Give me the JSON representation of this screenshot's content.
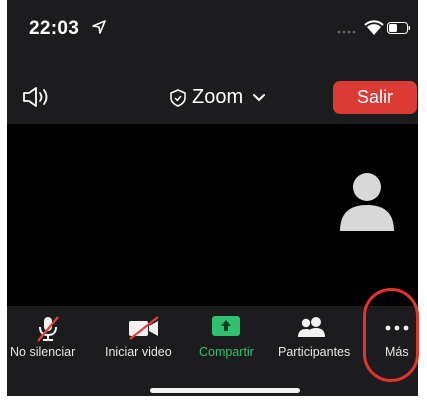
{
  "status": {
    "time": "22:03",
    "icons": [
      "location-arrow-icon",
      "signal-dots-icon",
      "wifi-icon",
      "battery-icon"
    ]
  },
  "header": {
    "title": "Zoom",
    "leave_label": "Salir",
    "icons": [
      "speaker-icon",
      "shield-icon",
      "chevron-down-icon"
    ]
  },
  "toolbar": {
    "items": [
      {
        "label": "No silenciar",
        "icon": "muted-microphone-icon"
      },
      {
        "label": "Iniciar video",
        "icon": "video-off-icon"
      },
      {
        "label": "Compartir",
        "icon": "share-screen-icon"
      },
      {
        "label": "Participantes",
        "icon": "participants-icon"
      },
      {
        "label": "Más",
        "icon": "more-dots-icon"
      }
    ]
  },
  "colors": {
    "background": "#1c1c1e",
    "video_background": "#000000",
    "leave_button": "#dc3b35",
    "share_green": "#2ec26e",
    "highlight_ring": "#e2352a"
  }
}
